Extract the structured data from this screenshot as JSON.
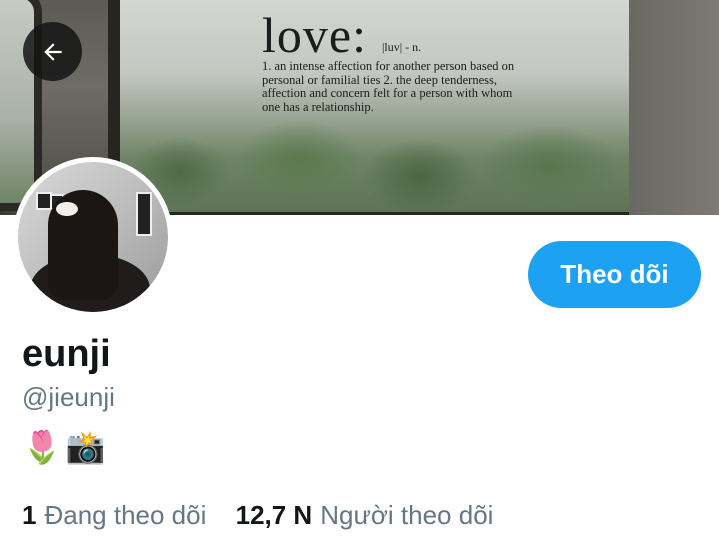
{
  "banner": {
    "headword": "love:",
    "pronunciation": "|luv| - n.",
    "definition": "1. an intense affection for another person based on personal or familial ties 2. the deep tenderness, affection and concern felt for a person with whom one has a relationship."
  },
  "nav": {
    "back_icon": "arrow-left-icon"
  },
  "profile": {
    "display_name": "eunji",
    "handle": "@jieunji",
    "bio_emojis": [
      "🌷",
      "📸"
    ]
  },
  "actions": {
    "follow_label": "Theo dõi"
  },
  "stats": {
    "following_count": "1",
    "following_label": "Đang theo dõi",
    "followers_count": "12,7 N",
    "followers_label": "Người theo dõi"
  },
  "colors": {
    "accent": "#1da1f2",
    "text_primary": "#14171a",
    "text_secondary": "#657786"
  }
}
